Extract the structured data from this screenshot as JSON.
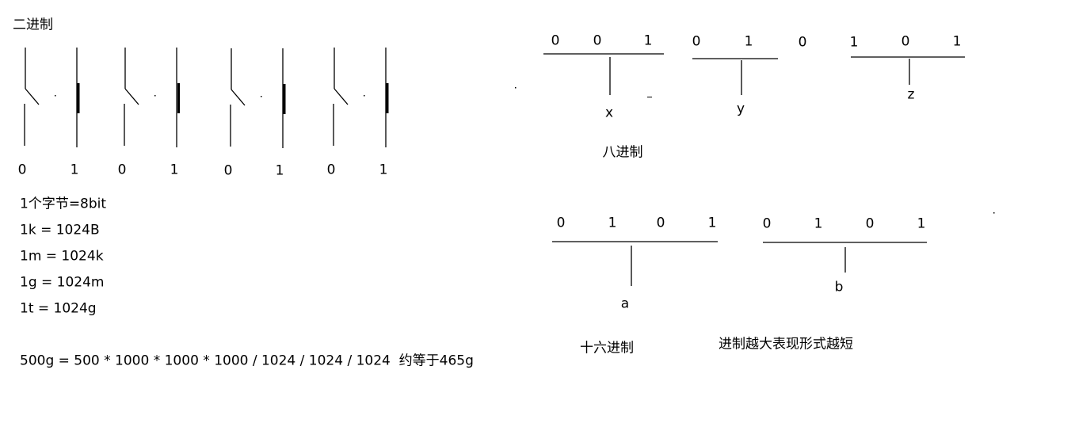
{
  "binary": {
    "title": "二进制",
    "switch_labels": [
      "0",
      "1",
      "0",
      "1",
      "0",
      "1",
      "0",
      "1"
    ]
  },
  "units": {
    "lines": [
      "1个字节=8bit",
      "1k = 1024B",
      "1m = 1024k",
      "1g = 1024m",
      "1t = 1024g"
    ],
    "calc": "500g = 500 * 1000 * 1000 * 1000 / 1024 / 1024 / 1024  约等于465g"
  },
  "octal": {
    "title": "八进制",
    "groups": [
      {
        "digits": [
          "0",
          "0",
          "1"
        ],
        "label": "x"
      },
      {
        "digits": [
          "0",
          "1",
          "0"
        ],
        "label": "y"
      },
      {
        "digits": [
          "1",
          "0",
          "1"
        ],
        "label": "z"
      }
    ]
  },
  "hex": {
    "title": "十六进制",
    "groups": [
      {
        "digits": [
          "0",
          "1",
          "0",
          "1"
        ],
        "label": "a"
      },
      {
        "digits": [
          "0",
          "1",
          "0",
          "1"
        ],
        "label": "b"
      }
    ]
  },
  "note": "进制越大表现形式越短"
}
